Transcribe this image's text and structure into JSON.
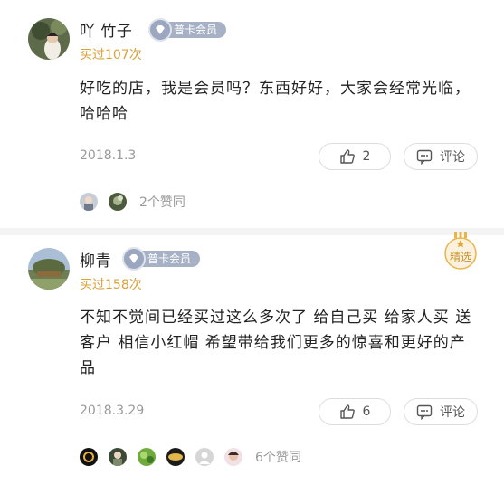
{
  "reviews": [
    {
      "username": "吖 竹子",
      "badge": "普卡会员",
      "bought": "买过107次",
      "content": "好吃的店，我是会员吗？东西好好，大家会经常光临，哈哈哈",
      "date": "2018.1.3",
      "likes": "2",
      "comment_label": "评论",
      "likers_count": "2个赞同",
      "featured": false
    },
    {
      "username": "柳青",
      "badge": "普卡会员",
      "bought": "买过158次",
      "content": "不知不觉间已经买过这么多次了 给自己买 给家人买 送客户 相信小红帽 希望带给我们更多的惊喜和更好的产品",
      "date": "2018.3.29",
      "likes": "6",
      "comment_label": "评论",
      "likers_count": "6个赞同",
      "featured": true,
      "featured_label": "精选"
    }
  ],
  "colors": {
    "gold": "#d9a23b",
    "badge": "#a7b1c5",
    "muted": "#999999"
  }
}
